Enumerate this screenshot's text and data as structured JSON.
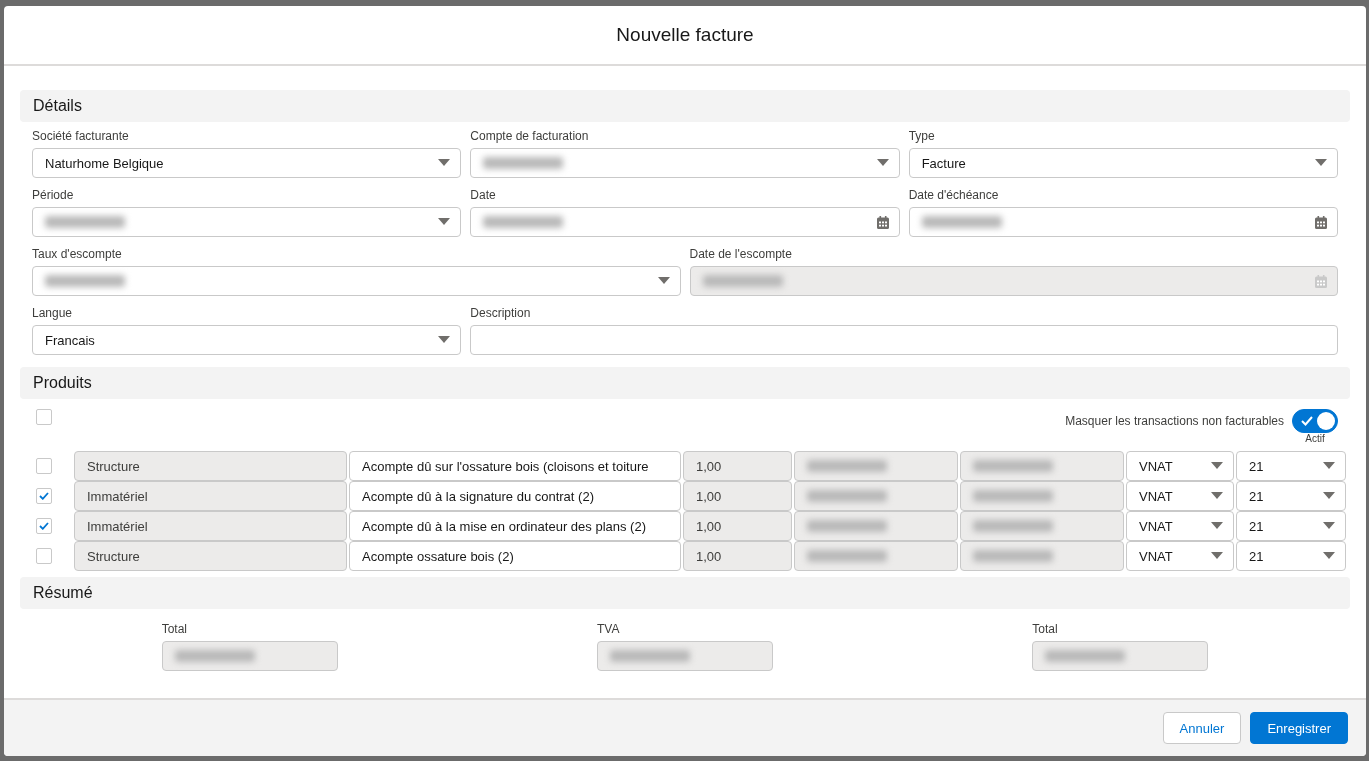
{
  "dialog": {
    "title": "Nouvelle facture"
  },
  "details": {
    "title": "Détails",
    "fields": [
      {
        "label": "Société facturante",
        "kind": "select",
        "value": "Naturhome Belgique",
        "redacted": false,
        "disabled": false
      },
      {
        "label": "Compte de facturation",
        "kind": "select",
        "redacted": true,
        "disabled": false
      },
      {
        "label": "Type",
        "kind": "select",
        "value": "Facture",
        "redacted": false,
        "disabled": false
      },
      {
        "label": "Période",
        "kind": "select",
        "redacted": true,
        "disabled": false
      },
      {
        "label": "Date",
        "kind": "date",
        "redacted": true,
        "disabled": false
      },
      {
        "label": "Date d'échéance",
        "kind": "date",
        "redacted": true,
        "disabled": false
      },
      {
        "label": "Taux d'escompte",
        "kind": "select",
        "redacted": true,
        "disabled": false
      },
      {
        "label": "Date de l'escompte",
        "kind": "date",
        "redacted": true,
        "disabled": true
      },
      {
        "label": "Langue",
        "kind": "select",
        "value": "Francais",
        "redacted": false,
        "disabled": false
      },
      {
        "label": "Description",
        "kind": "text",
        "redacted": false,
        "disabled": false
      }
    ]
  },
  "products": {
    "title": "Produits",
    "select_all": {
      "checked": false
    },
    "toggle": {
      "label": "Masquer les transactions non facturables",
      "on": true,
      "status": "Actif"
    },
    "rows": [
      {
        "checked": false,
        "category": "Structure",
        "description": "Acompte dû sur l'ossature bois (cloisons et toiture",
        "quantity": "1,00",
        "price_redacted": true,
        "amount_redacted": true,
        "unit": "VNAT",
        "vat": "21"
      },
      {
        "checked": true,
        "category": "Immatériel",
        "description": "Acompte dû à la signature du contrat (2)",
        "quantity": "1,00",
        "price_redacted": true,
        "amount_redacted": true,
        "unit": "VNAT",
        "vat": "21"
      },
      {
        "checked": true,
        "category": "Immatériel",
        "description": "Acompte dû à la mise en ordinateur des plans (2)",
        "quantity": "1,00",
        "price_redacted": true,
        "amount_redacted": true,
        "unit": "VNAT",
        "vat": "21"
      },
      {
        "checked": false,
        "category": "Structure",
        "description": "Acompte ossature bois (2)",
        "quantity": "1,00",
        "price_redacted": true,
        "amount_redacted": true,
        "unit": "VNAT",
        "vat": "21"
      }
    ]
  },
  "summary": {
    "title": "Résumé",
    "fields": [
      {
        "label": "Total",
        "redacted": true
      },
      {
        "label": "TVA",
        "redacted": true
      },
      {
        "label": "Total",
        "redacted": true
      }
    ]
  },
  "buttons": [
    {
      "label": "Annuler",
      "kind": "secondary"
    },
    {
      "label": "Enregistrer",
      "kind": "primary"
    }
  ]
}
